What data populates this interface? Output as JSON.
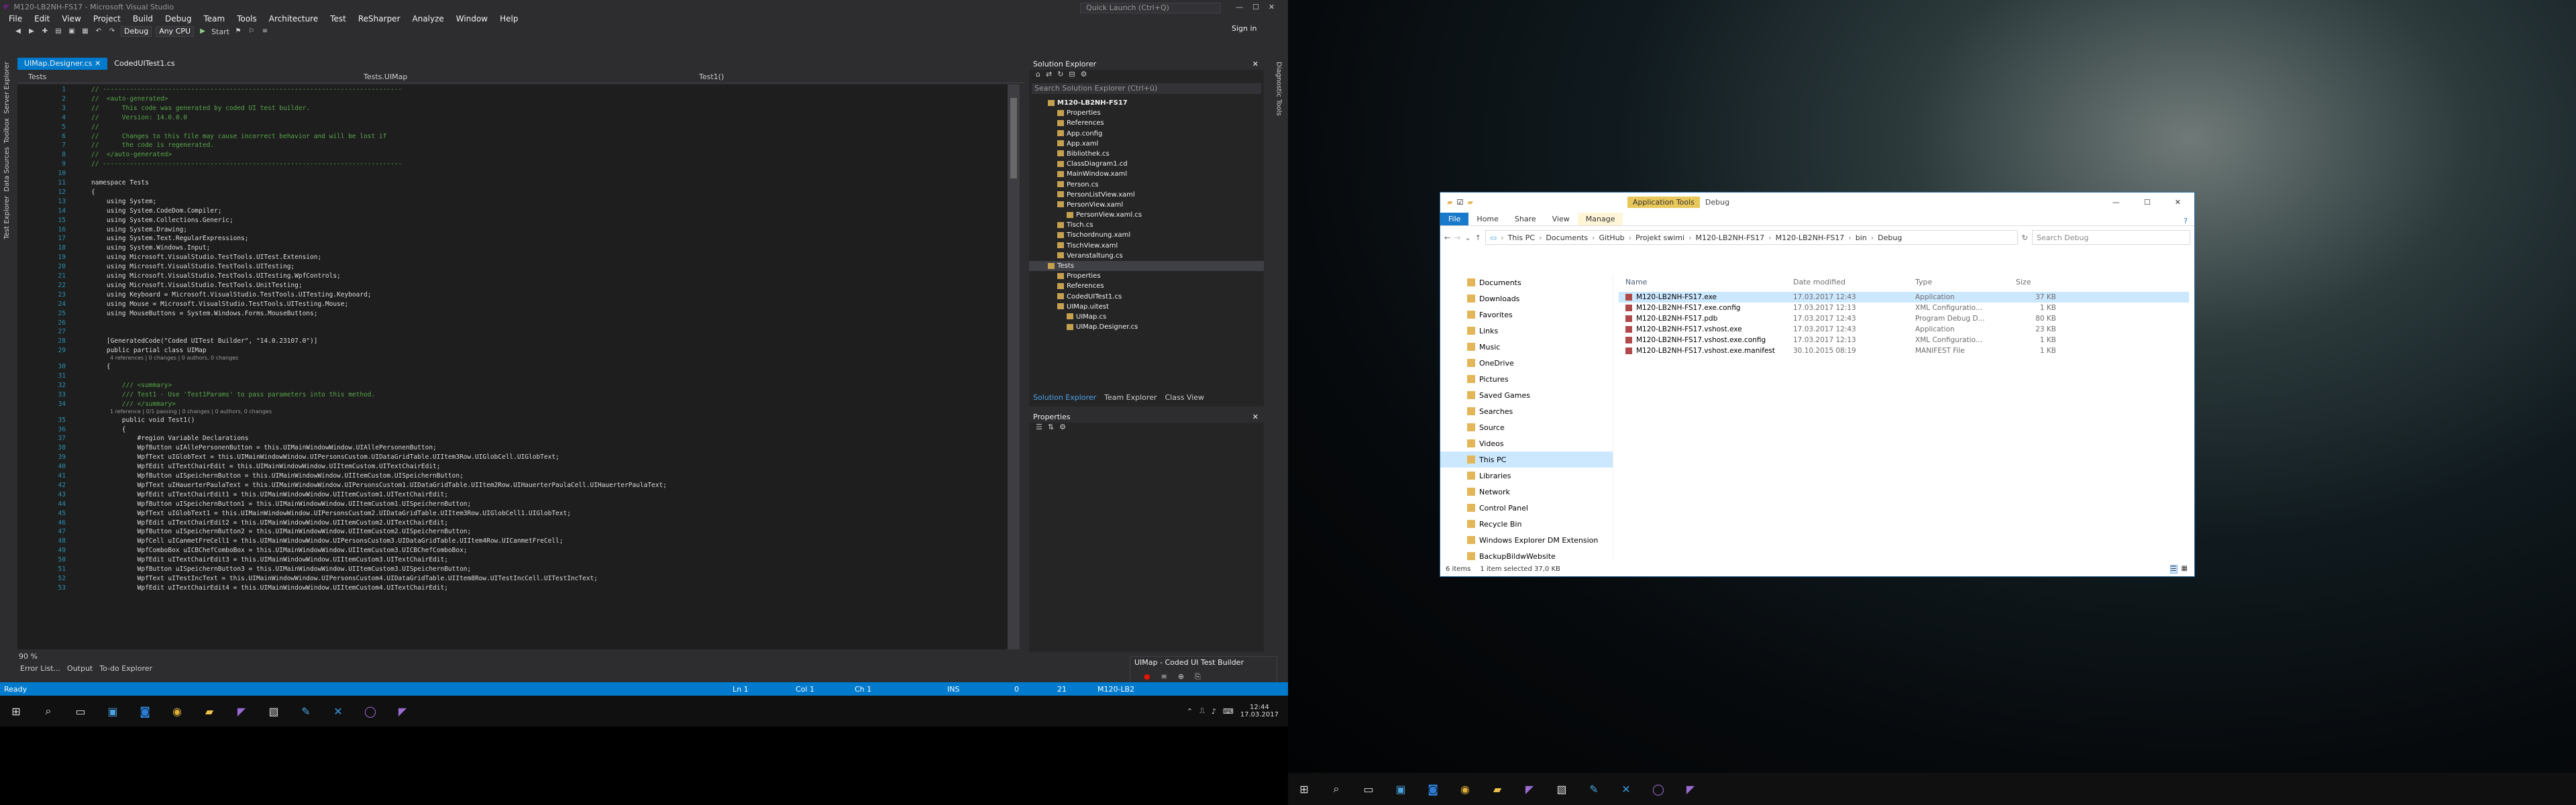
{
  "vs": {
    "title": "M120-LB2NH-FS17 - Microsoft Visual Studio",
    "quick_launch": "Quick Launch (Ctrl+Q)",
    "sign_in": "Sign in",
    "menu": [
      "File",
      "Edit",
      "View",
      "Project",
      "Build",
      "Debug",
      "Team",
      "Tools",
      "Architecture",
      "Test",
      "ReSharper",
      "Analyze",
      "Window",
      "Help"
    ],
    "toolbar": {
      "config": "Debug",
      "platform": "Any CPU",
      "start": "Start"
    },
    "left_tabs": [
      "Server Explorer",
      "Toolbox",
      "Data Sources",
      "Test Explorer"
    ],
    "editor_tabs": [
      "UIMap.Designer.cs",
      "CodedUITest1.cs"
    ],
    "nav": {
      "project": "Tests",
      "class": "Tests.UIMap",
      "member": "Test1()"
    },
    "zoom": "90 %",
    "code_lines": [
      {
        "n": "1",
        "t": "// ------------------------------------------------------------------------------",
        "c": "cm"
      },
      {
        "n": "2",
        "t": "//  <auto-generated>",
        "c": "cm"
      },
      {
        "n": "3",
        "t": "//      This code was generated by coded UI test builder.",
        "c": "cm"
      },
      {
        "n": "4",
        "t": "//      Version: 14.0.0.0",
        "c": "cm"
      },
      {
        "n": "5",
        "t": "//",
        "c": "cm"
      },
      {
        "n": "6",
        "t": "//      Changes to this file may cause incorrect behavior and will be lost if",
        "c": "cm"
      },
      {
        "n": "7",
        "t": "//      the code is regenerated.",
        "c": "cm"
      },
      {
        "n": "8",
        "t": "//  </auto-generated>",
        "c": "cm"
      },
      {
        "n": "9",
        "t": "// ------------------------------------------------------------------------------",
        "c": "cm"
      },
      {
        "n": "10",
        "t": "",
        "c": ""
      },
      {
        "n": "11",
        "t": "namespace Tests",
        "c": ""
      },
      {
        "n": "12",
        "t": "{",
        "c": ""
      },
      {
        "n": "13",
        "t": "    using System;",
        "c": ""
      },
      {
        "n": "14",
        "t": "    using System.CodeDom.Compiler;",
        "c": ""
      },
      {
        "n": "15",
        "t": "    using System.Collections.Generic;",
        "c": ""
      },
      {
        "n": "16",
        "t": "    using System.Drawing;",
        "c": ""
      },
      {
        "n": "17",
        "t": "    using System.Text.RegularExpressions;",
        "c": ""
      },
      {
        "n": "18",
        "t": "    using System.Windows.Input;",
        "c": ""
      },
      {
        "n": "19",
        "t": "    using Microsoft.VisualStudio.TestTools.UITest.Extension;",
        "c": ""
      },
      {
        "n": "20",
        "t": "    using Microsoft.VisualStudio.TestTools.UITesting;",
        "c": ""
      },
      {
        "n": "21",
        "t": "    using Microsoft.VisualStudio.TestTools.UITesting.WpfControls;",
        "c": ""
      },
      {
        "n": "22",
        "t": "    using Microsoft.VisualStudio.TestTools.UnitTesting;",
        "c": ""
      },
      {
        "n": "23",
        "t": "    using Keyboard = Microsoft.VisualStudio.TestTools.UITesting.Keyboard;",
        "c": ""
      },
      {
        "n": "24",
        "t": "    using Mouse = Microsoft.VisualStudio.TestTools.UITesting.Mouse;",
        "c": ""
      },
      {
        "n": "25",
        "t": "    using MouseButtons = System.Windows.Forms.MouseButtons;",
        "c": ""
      },
      {
        "n": "26",
        "t": "",
        "c": ""
      },
      {
        "n": "27",
        "t": "",
        "c": ""
      },
      {
        "n": "28",
        "t": "    [GeneratedCode(\"Coded UITest Builder\", \"14.0.23107.0\")]",
        "c": ""
      },
      {
        "n": "29",
        "t": "    public partial class UIMap",
        "c": ""
      },
      {
        "n": "30",
        "t": "    {",
        "c": ""
      },
      {
        "n": "31",
        "t": "",
        "c": ""
      },
      {
        "n": "32",
        "t": "        /// <summary>",
        "c": "cm"
      },
      {
        "n": "33",
        "t": "        /// Test1 - Use 'Test1Params' to pass parameters into this method.",
        "c": "cm"
      },
      {
        "n": "34",
        "t": "        /// </summary>",
        "c": "cm"
      },
      {
        "n": "35",
        "t": "        public void Test1()",
        "c": ""
      },
      {
        "n": "36",
        "t": "        {",
        "c": ""
      },
      {
        "n": "37",
        "t": "            #region Variable Declarations",
        "c": ""
      },
      {
        "n": "38",
        "t": "            WpfButton uIAllePersonenButton = this.UIMainWindowWindow.UIAllePersonenButton;",
        "c": ""
      },
      {
        "n": "39",
        "t": "            WpfText uIGlobText = this.UIMainWindowWindow.UIPersonsCustom.UIDataGridTable.UIItem3Row.UIGlobCell.UIGlobText;",
        "c": ""
      },
      {
        "n": "40",
        "t": "            WpfEdit uITextChairEdit = this.UIMainWindowWindow.UIItemCustom.UITextChairEdit;",
        "c": ""
      },
      {
        "n": "41",
        "t": "            WpfButton uISpeichernButton = this.UIMainWindowWindow.UIItemCustom.UISpeichernButton;",
        "c": ""
      },
      {
        "n": "42",
        "t": "            WpfText uIHauerterPaulaText = this.UIMainWindowWindow.UIPersonsCustom1.UIDataGridTable.UIItem2Row.UIHauerterPaulaCell.UIHauerterPaulaText;",
        "c": ""
      },
      {
        "n": "43",
        "t": "            WpfEdit uITextChairEdit1 = this.UIMainWindowWindow.UIItemCustom1.UITextChairEdit;",
        "c": ""
      },
      {
        "n": "44",
        "t": "            WpfButton uISpeichernButton1 = this.UIMainWindowWindow.UIItemCustom1.UISpeichernButton;",
        "c": ""
      },
      {
        "n": "45",
        "t": "            WpfText uIGlobText1 = this.UIMainWindowWindow.UIPersonsCustom2.UIDataGridTable.UIItem3Row.UIGlobCell1.UIGlobText;",
        "c": ""
      },
      {
        "n": "46",
        "t": "            WpfEdit uITextChairEdit2 = this.UIMainWindowWindow.UIItemCustom2.UITextChairEdit;",
        "c": ""
      },
      {
        "n": "47",
        "t": "            WpfButton uISpeichernButton2 = this.UIMainWindowWindow.UIItemCustom2.UISpeichernButton;",
        "c": ""
      },
      {
        "n": "48",
        "t": "            WpfCell uICanmetFreCell1 = this.UIMainWindowWindow.UIPersonsCustom3.UIDataGridTable.UIItem4Row.UICanmetFreCell;",
        "c": ""
      },
      {
        "n": "49",
        "t": "            WpfComboBox uICBChefComboBox = this.UIMainWindowWindow.UIItemCustom3.UICBChefComboBox;",
        "c": ""
      },
      {
        "n": "50",
        "t": "            WpfEdit uITextChairEdit3 = this.UIMainWindowWindow.UIItemCustom3.UITextChairEdit;",
        "c": ""
      },
      {
        "n": "51",
        "t": "            WpfButton uISpeichernButton3 = this.UIMainWindowWindow.UIItemCustom3.UISpeichernButton;",
        "c": ""
      },
      {
        "n": "52",
        "t": "            WpfText uITestIncText = this.UIMainWindowWindow.UIPersonsCustom4.UIDataGridTable.UIItem8Row.UITestIncCell.UITestIncText;",
        "c": ""
      },
      {
        "n": "53",
        "t": "            WpfEdit uITextChairEdit4 = this.UIMainWindowWindow.UIItemCustom4.UITextChairEdit;",
        "c": ""
      }
    ],
    "lens_lines": [
      {
        "after": "29",
        "t": "4 references | 0 changes | 0 authors, 0 changes"
      },
      {
        "after": "34",
        "t": "1 reference | 0/1 passing | 0 changes | 0 authors, 0 changes"
      }
    ],
    "bottom_tabs": [
      "Error List...",
      "Output",
      "To-do Explorer"
    ],
    "solution_explorer": {
      "title": "Solution Explorer",
      "search": "Search Solution Explorer (Ctrl+ü)",
      "items": [
        {
          "label": "M120-LB2NH-FS17",
          "indent": 1,
          "bold": true
        },
        {
          "label": "Properties",
          "indent": 2
        },
        {
          "label": "References",
          "indent": 2
        },
        {
          "label": "App.config",
          "indent": 2
        },
        {
          "label": "App.xaml",
          "indent": 2
        },
        {
          "label": "Bibliothek.cs",
          "indent": 2
        },
        {
          "label": "ClassDiagram1.cd",
          "indent": 2
        },
        {
          "label": "MainWindow.xaml",
          "indent": 2
        },
        {
          "label": "Person.cs",
          "indent": 2
        },
        {
          "label": "PersonListView.xaml",
          "indent": 2
        },
        {
          "label": "PersonView.xaml",
          "indent": 2
        },
        {
          "label": "PersonView.xaml.cs",
          "indent": 3
        },
        {
          "label": "Tisch.cs",
          "indent": 2
        },
        {
          "label": "Tischordnung.xaml",
          "indent": 2
        },
        {
          "label": "TischView.xaml",
          "indent": 2
        },
        {
          "label": "Veranstaltung.cs",
          "indent": 2
        },
        {
          "label": "Tests",
          "indent": 1,
          "selected": true
        },
        {
          "label": "Properties",
          "indent": 2
        },
        {
          "label": "References",
          "indent": 2
        },
        {
          "label": "CodedUITest1.cs",
          "indent": 2
        },
        {
          "label": "UIMap.uitest",
          "indent": 2
        },
        {
          "label": "UIMap.cs",
          "indent": 3
        },
        {
          "label": "UIMap.Designer.cs",
          "indent": 3
        }
      ],
      "tabs": [
        "Solution Explorer",
        "Team Explorer",
        "Class View"
      ]
    },
    "properties": {
      "title": "Properties"
    },
    "right_tabs": [
      "Diagnostic Tools"
    ],
    "uimap_panel": {
      "title": "UIMap - Coded UI Test Builder"
    },
    "status": {
      "ready": "Ready",
      "ln": "Ln 1",
      "col": "Col 1",
      "ch": "Ch 1",
      "ins": "INS",
      "errors": "0",
      "changes": "21",
      "project": "M120-LB2"
    },
    "clock": {
      "time": "12:44",
      "date": "17.03.2017"
    }
  },
  "explorer": {
    "ribbon_context": "Application Tools",
    "ribbon_title": "Debug",
    "tabs": [
      "File",
      "Home",
      "Share",
      "View",
      "Manage"
    ],
    "breadcrumb": [
      "This PC",
      "Documents",
      "GitHub",
      "Projekt swimi",
      "M120-LB2NH-FS17",
      "M120-LB2NH-FS17",
      "bin",
      "Debug"
    ],
    "search_placeholder": "Search Debug",
    "nav": [
      {
        "label": "Documents"
      },
      {
        "label": "Downloads"
      },
      {
        "label": "Favorites"
      },
      {
        "label": "Links"
      },
      {
        "label": "Music"
      },
      {
        "label": "OneDrive"
      },
      {
        "label": "Pictures"
      },
      {
        "label": "Saved Games"
      },
      {
        "label": "Searches"
      },
      {
        "label": "Source"
      },
      {
        "label": "Videos"
      },
      {
        "label": "This PC",
        "selected": true
      },
      {
        "label": "Libraries"
      },
      {
        "label": "Network"
      },
      {
        "label": "Control Panel"
      },
      {
        "label": "Recycle Bin"
      },
      {
        "label": "Windows Explorer DM Extension"
      },
      {
        "label": "BackupBildwWebsite"
      }
    ],
    "columns": [
      "Name",
      "Date modified",
      "Type",
      "Size"
    ],
    "files": [
      {
        "name": "M120-LB2NH-FS17.exe",
        "date": "17.03.2017 12:43",
        "type": "Application",
        "size": "37 KB",
        "selected": true
      },
      {
        "name": "M120-LB2NH-FS17.exe.config",
        "date": "17.03.2017 12:13",
        "type": "XML Configuratio...",
        "size": "1 KB"
      },
      {
        "name": "M120-LB2NH-FS17.pdb",
        "date": "17.03.2017 12:43",
        "type": "Program Debug D...",
        "size": "80 KB"
      },
      {
        "name": "M120-LB2NH-FS17.vshost.exe",
        "date": "17.03.2017 12:43",
        "type": "Application",
        "size": "23 KB"
      },
      {
        "name": "M120-LB2NH-FS17.vshost.exe.config",
        "date": "17.03.2017 12:13",
        "type": "XML Configuratio...",
        "size": "1 KB"
      },
      {
        "name": "M120-LB2NH-FS17.vshost.exe.manifest",
        "date": "30.10.2015 08:19",
        "type": "MANIFEST File",
        "size": "1 KB"
      }
    ],
    "status": {
      "count": "6 items",
      "selected": "1 item selected  37,0 KB"
    }
  }
}
